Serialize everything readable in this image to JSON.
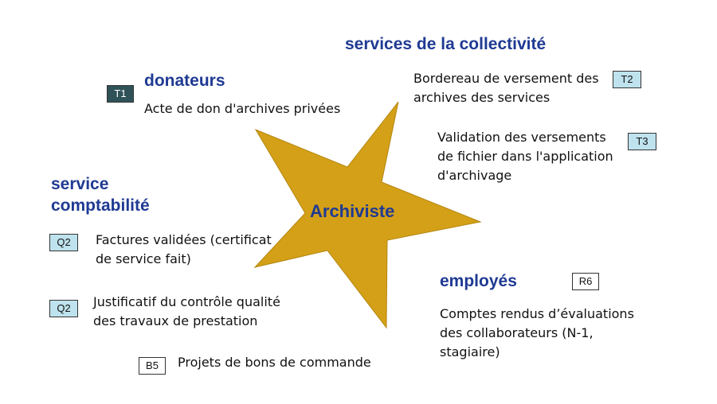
{
  "center": {
    "label": "Archiviste",
    "star_color": "#d4a017"
  },
  "groups": {
    "collectivite": {
      "heading": "services de la collectivité"
    },
    "donateurs": {
      "heading": "donateurs",
      "tag": "T1",
      "item": "Acte de don d'archives privées"
    },
    "comptabilite": {
      "heading_line1": "service",
      "heading_line2": "comptabilité"
    },
    "employes": {
      "heading": "employés",
      "tag": "R6"
    }
  },
  "items": {
    "t2": {
      "tag": "T2",
      "line1": "Bordereau de versement des",
      "line2": "archives des services"
    },
    "t3": {
      "tag": "T3",
      "line1": "Validation des versements",
      "line2": "de fichier dans l'application",
      "line3": "d'archivage"
    },
    "q2a": {
      "tag": "Q2",
      "line1": "Factures validées (certificat",
      "line2": "de service fait)"
    },
    "q2b": {
      "tag": "Q2",
      "line1": "Justificatif  du contrôle qualité",
      "line2": "des travaux de prestation"
    },
    "b5": {
      "tag": "B5",
      "line1": "Projets de bons de commande"
    },
    "r6": {
      "line1": "Comptes rendus d’évaluations",
      "line2": "des collaborateurs (N-1,",
      "line3": "stagiaire)"
    }
  }
}
